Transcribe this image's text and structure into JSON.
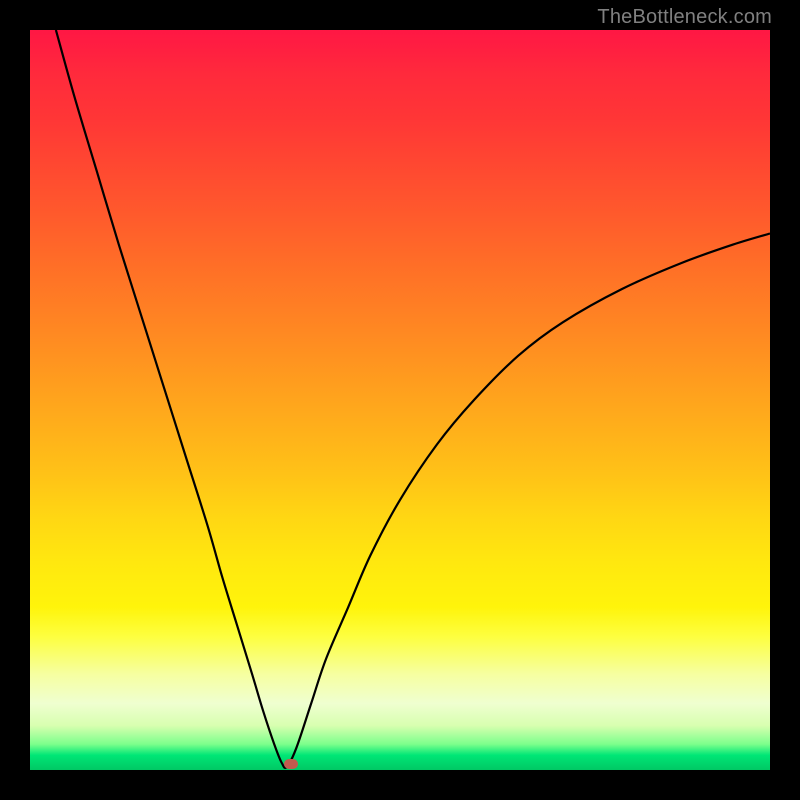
{
  "credit": "TheBottleneck.com",
  "colors": {
    "curve_stroke": "#000000",
    "marker_fill": "#c25b4e",
    "frame_bg": "#000000",
    "credit_text": "#808080"
  },
  "chart_data": {
    "type": "line",
    "title": "",
    "xlabel": "",
    "ylabel": "",
    "xlim": [
      0,
      100
    ],
    "ylim": [
      0,
      100
    ],
    "grid": false,
    "legend": false,
    "series": [
      {
        "name": "bottleneck-curve",
        "x": [
          3.5,
          6,
          9,
          12,
          15,
          18,
          21,
          24,
          26,
          28,
          30,
          31.5,
          33,
          34,
          34.7,
          36,
          38,
          40,
          43,
          46,
          50,
          55,
          60,
          66,
          72,
          80,
          88,
          95,
          100
        ],
        "y": [
          100,
          91,
          81,
          71,
          61.5,
          52,
          42.5,
          33,
          26,
          19.5,
          13,
          8,
          3.5,
          1,
          0.4,
          3,
          9,
          15,
          22,
          29,
          36.5,
          44,
          50,
          56,
          60.5,
          65,
          68.5,
          71,
          72.5
        ]
      }
    ],
    "marker": {
      "x": 35.3,
      "y": 0.8
    },
    "gradient_stops": [
      {
        "pos": 0,
        "color": "#ff1744"
      },
      {
        "pos": 25,
        "color": "#ff5a2c"
      },
      {
        "pos": 50,
        "color": "#ffad1b"
      },
      {
        "pos": 72,
        "color": "#ffe80f"
      },
      {
        "pos": 87,
        "color": "#f6ffa0"
      },
      {
        "pos": 96,
        "color": "#7dff8c"
      },
      {
        "pos": 100,
        "color": "#00c864"
      }
    ]
  }
}
